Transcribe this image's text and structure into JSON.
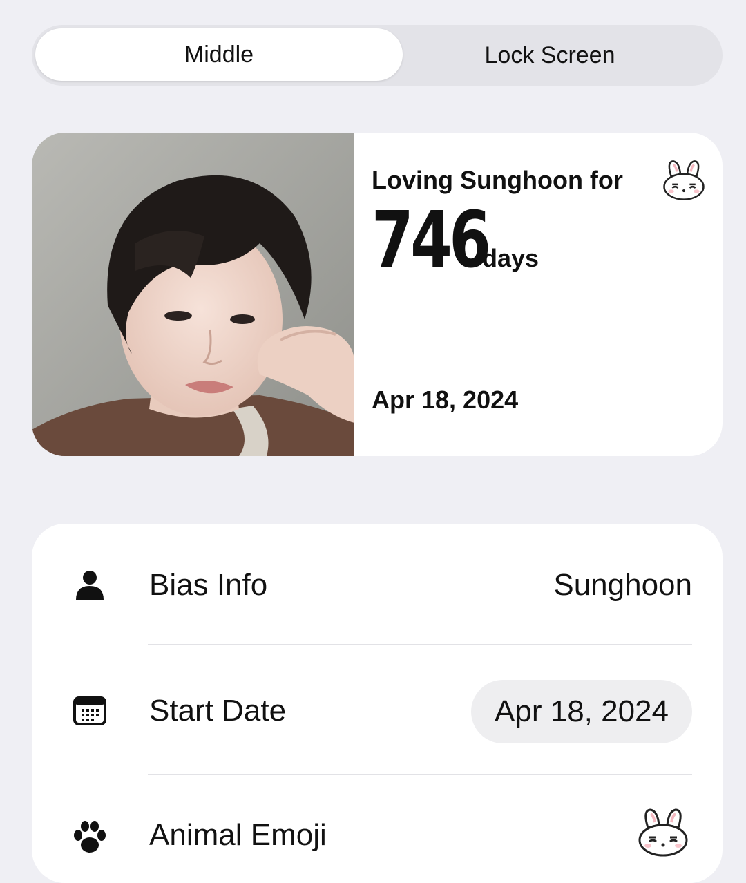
{
  "tabs": [
    {
      "label": "Middle",
      "active": true
    },
    {
      "label": "Lock Screen",
      "active": false
    }
  ],
  "widget": {
    "title": "Loving Sunghoon for",
    "days_count": "746",
    "days_unit": "days",
    "start_date": "Apr 18, 2024",
    "emoji": "bunny-emoji-icon"
  },
  "settings": {
    "rows": [
      {
        "icon": "person-icon",
        "label": "Bias Info",
        "value": "Sunghoon"
      },
      {
        "icon": "calendar-icon",
        "label": "Start Date",
        "value": "Apr 18, 2024"
      },
      {
        "icon": "paw-icon",
        "label": "Animal Emoji",
        "value": "bunny-emoji-icon"
      }
    ]
  },
  "colors": {
    "background": "#efeff4",
    "card": "#ffffff",
    "segment_track": "#e3e3e8",
    "pill": "#eeeef0",
    "text": "#111111"
  }
}
